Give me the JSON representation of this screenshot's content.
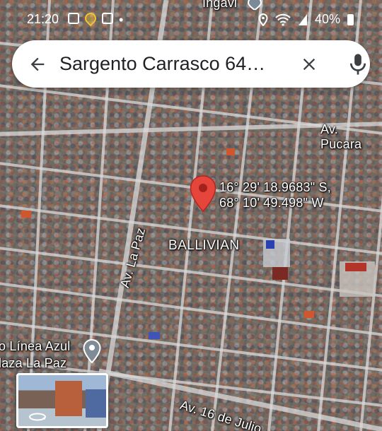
{
  "status_bar": {
    "time": "21:20",
    "battery": "40%"
  },
  "search": {
    "query": "Sargento Carrasco 64…"
  },
  "map": {
    "pin_coords_line1": "16° 29' 18.9683\" S,",
    "pin_coords_line2": "68° 10' 49.498\" W",
    "labels": {
      "top_partial": "Ingavi",
      "av_pucara": "Av. Pucara",
      "av_la_paz": "Av. La Paz",
      "ballivian": "BALLIVIAN",
      "poi_line1": "o Línea Azul",
      "poi_line2": "laza La Paz",
      "av_16_julio": "Av. 16 de Julio"
    }
  },
  "icons": {
    "back": "arrow-back-icon",
    "clear": "close-icon",
    "mic": "microphone-icon",
    "pin": "red-location-pin-icon",
    "poi": "grey-location-pin-icon",
    "street_view": "street-view-360-icon"
  },
  "colors": {
    "pin_red": "#e5453b",
    "road": "#d9d9d9"
  }
}
